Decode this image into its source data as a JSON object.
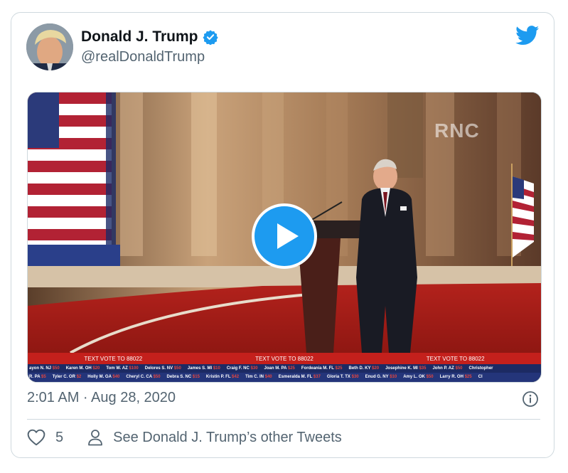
{
  "tweet": {
    "author": {
      "display_name": "Donald J. Trump",
      "handle": "@realDonaldTrump",
      "verified": true
    },
    "media": {
      "watermark": "RNC",
      "ticker": {
        "vote_banners": [
          "TEXT VOTE TO 88022",
          "TEXT VOTE TO 88022",
          "TEXT VOTE TO 88022"
        ],
        "row1": [
          [
            "ayon N. NJ",
            "$50"
          ],
          [
            "Karen M. OH",
            "$20"
          ],
          [
            "Tom W. AZ",
            "$100"
          ],
          [
            "Delores S. NV",
            "$50"
          ],
          [
            "James S. MI",
            "$10"
          ],
          [
            "Craig F. NC",
            "$30"
          ],
          [
            "Joan M. PA",
            "$25"
          ],
          [
            "Fordeania M. FL",
            "$25"
          ],
          [
            "Beth D. KY",
            "$20"
          ],
          [
            "Josephine K. MI",
            "$35"
          ],
          [
            "John P. AZ",
            "$50"
          ],
          [
            "Christopher",
            ""
          ]
        ],
        "row2": [
          [
            "R. PA",
            "$5"
          ],
          [
            "Tyler C. OR",
            "$2"
          ],
          [
            "Holly M. GA",
            "$40"
          ],
          [
            "Cheryl C. CA",
            "$50"
          ],
          [
            "Debra S. NC",
            "$15"
          ],
          [
            "Kristin P. FL",
            "$42"
          ],
          [
            "Tim C. IN",
            "$40"
          ],
          [
            "Esmeralda M. FL",
            "$37"
          ],
          [
            "Gloria T. TX",
            "$30"
          ],
          [
            "Enud G. NY",
            "$10"
          ],
          [
            "Amy L. OK",
            "$50"
          ],
          [
            "Larry R. OH",
            "$25"
          ],
          [
            "Cl",
            ""
          ]
        ]
      }
    },
    "timestamp": "2:01 AM · Aug 28, 2020",
    "like_count": "5",
    "other_tweets_label": "See Donald J. Trump’s other Tweets"
  },
  "icons": {
    "brand": "twitter-bird-icon",
    "verified": "verified-badge-icon",
    "play": "play-icon",
    "info": "info-icon",
    "like": "heart-icon",
    "profile": "person-icon"
  },
  "colors": {
    "brand_blue": "#1d9bf0",
    "text_primary": "#0f1419",
    "text_secondary": "#536471",
    "border": "#cfd9de",
    "ticker_red": "#c4201c",
    "ticker_blue": "#1c2a63"
  }
}
